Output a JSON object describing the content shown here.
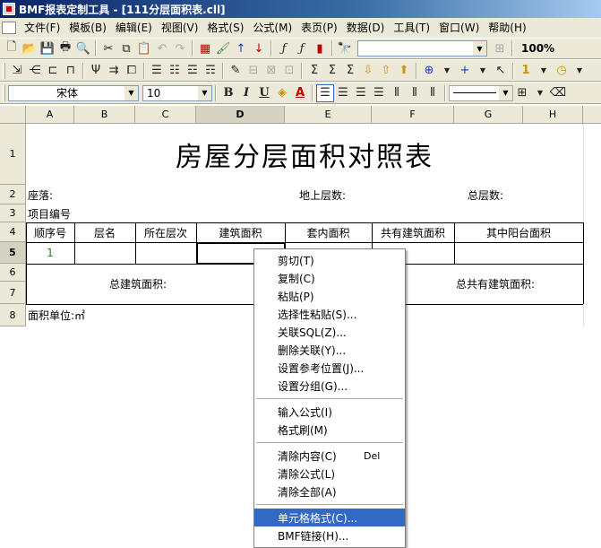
{
  "titlebar": {
    "title": "BMF报表定制工具 - [111分层面积表.cll]"
  },
  "menubar": {
    "items": [
      "文件(F)",
      "模板(B)",
      "编辑(E)",
      "视图(V)",
      "格式(S)",
      "公式(M)",
      "表页(P)",
      "数据(D)",
      "工具(T)",
      "窗口(W)",
      "帮助(H)"
    ]
  },
  "toolbar1": {
    "zoom": "100%"
  },
  "toolbar3": {
    "font_name": "宋体",
    "font_size": "10",
    "bold": "B",
    "italic": "I",
    "underline": "U",
    "font_color_glyph": "A"
  },
  "sheet": {
    "columns": [
      "A",
      "B",
      "C",
      "D",
      "E",
      "F",
      "G",
      "H"
    ],
    "rows": [
      "1",
      "2",
      "3",
      "4",
      "5",
      "6",
      "7",
      "8"
    ],
    "title": "房屋分层面积对照表",
    "row2": {
      "location": "座落:",
      "above_ground_floors": "地上层数:",
      "total_floors": "总层数:"
    },
    "row3": {
      "project_no": "项目编号"
    },
    "headers": [
      "顺序号",
      "层名",
      "所在层次",
      "建筑面积",
      "套内面积",
      "共有建筑面积",
      "其中阳台面积"
    ],
    "row5": {
      "seq": "1"
    },
    "total_area": "总建筑面积:",
    "total_shared_area": "总共有建筑面积:",
    "unit": "面积单位:㎡"
  },
  "context_menu": {
    "items": [
      {
        "label": "剪切(T)"
      },
      {
        "label": "复制(C)"
      },
      {
        "label": "粘贴(P)"
      },
      {
        "label": "选择性粘贴(S)..."
      },
      {
        "label": "关联SQL(Z)..."
      },
      {
        "label": "删除关联(Y)..."
      },
      {
        "label": "设置参考位置(J)..."
      },
      {
        "label": "设置分组(G)..."
      },
      {
        "label": "输入公式(I)"
      },
      {
        "label": "格式刷(M)"
      },
      {
        "label": "清除内容(C)",
        "accel": "Del"
      },
      {
        "label": "清除公式(L)"
      },
      {
        "label": "清除全部(A)"
      },
      {
        "label": "单元格格式(C)...",
        "highlighted": true
      },
      {
        "label": "BMF链接(H)..."
      }
    ]
  },
  "colors": {
    "titlebar": "#0a246a",
    "chrome": "#ece9d8",
    "highlight": "#316ac5"
  }
}
